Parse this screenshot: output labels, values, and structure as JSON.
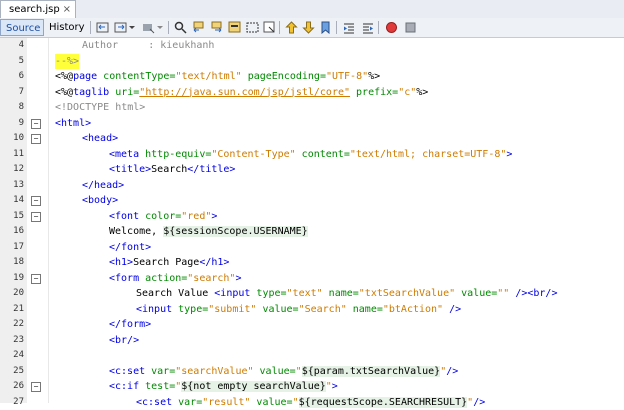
{
  "tab": {
    "filename": "search.jsp",
    "close": "×"
  },
  "toolbar": {
    "source_label": "Source",
    "history_label": "History"
  },
  "editor": {
    "lines": [
      {
        "n": "4"
      },
      {
        "n": "5"
      },
      {
        "n": "6"
      },
      {
        "n": "7"
      },
      {
        "n": "8"
      },
      {
        "n": "9"
      },
      {
        "n": "10"
      },
      {
        "n": "11"
      },
      {
        "n": "12"
      },
      {
        "n": "13"
      },
      {
        "n": "14"
      },
      {
        "n": "15"
      },
      {
        "n": "16"
      },
      {
        "n": "17"
      },
      {
        "n": "18"
      },
      {
        "n": "19"
      },
      {
        "n": "20"
      },
      {
        "n": "21"
      },
      {
        "n": "22"
      },
      {
        "n": "23"
      },
      {
        "n": "24"
      },
      {
        "n": "25"
      },
      {
        "n": "26"
      },
      {
        "n": "27"
      }
    ],
    "c4": "Author     : kieukhanh",
    "c5": "--%>",
    "c6a": "<%@",
    "c6b": "page",
    "c6c": " contentType=",
    "c6d": "\"text/html\"",
    "c6e": " pageEncoding=",
    "c6f": "\"UTF-8\"",
    "c6g": "%>",
    "c7a": "<%@",
    "c7b": "taglib",
    "c7c": " uri=",
    "c7d": "\"http://java.sun.com/jsp/jstl/core\"",
    "c7e": " prefix=",
    "c7f": "\"c\"",
    "c7g": "%>",
    "c8": "<!DOCTYPE html>",
    "c9": "<html>",
    "c10": "<head>",
    "c11a": "<meta",
    "c11b": " http-equiv=",
    "c11c": "\"Content-Type\"",
    "c11d": " content=",
    "c11e": "\"text/html; charset=UTF-8\"",
    "c11f": ">",
    "c12a": "<title>",
    "c12b": "Search",
    "c12c": "</title>",
    "c13": "</head>",
    "c14": "<body>",
    "c15a": "<font",
    "c15b": " color=",
    "c15c": "\"red\"",
    "c15d": ">",
    "c16a": "Welcome, ",
    "c16b": "${sessionScope.USERNAME}",
    "c17": "</font>",
    "c18a": "<h1>",
    "c18b": "Search Page",
    "c18c": "</h1>",
    "c19a": "<form",
    "c19b": " action=",
    "c19c": "\"search\"",
    "c19d": ">",
    "c20a": "Search Value ",
    "c20b": "<input",
    "c20c": " type=",
    "c20d": "\"text\"",
    "c20e": " name=",
    "c20f": "\"txtSearchValue\"",
    "c20g": " value=",
    "c20h": "\"\"",
    "c20i": " />",
    "c20j": "<br/>",
    "c21a": "<input",
    "c21b": " type=",
    "c21c": "\"submit\"",
    "c21d": " value=",
    "c21e": "\"Search\"",
    "c21f": " name=",
    "c21g": "\"btAction\"",
    "c21h": " />",
    "c22": "</form>",
    "c23": "<br/>",
    "c25a": "<c:set",
    "c25b": " var=",
    "c25c": "\"searchValue\"",
    "c25d": " value=",
    "c25e": "\"",
    "c25f": "${param.txtSearchValue}",
    "c25g": "\"",
    "c25h": "/>",
    "c26a": "<c:if",
    "c26b": " test=",
    "c26c": "\"",
    "c26d": "${not empty searchValue}",
    "c26e": "\"",
    "c26f": ">",
    "c27a": "<c:set",
    "c27b": " var=",
    "c27c": "\"result\"",
    "c27d": " value=",
    "c27e": "\"",
    "c27f": "${requestScope.SEARCHRESULT}",
    "c27g": "\"",
    "c27h": "/>"
  },
  "icons": [
    "back-history-icon",
    "forward-history-icon",
    "dropdown-icon",
    "find-icon",
    "find-prev-icon",
    "find-next-icon",
    "toggle-highlight-icon",
    "toggle-rect-select-icon",
    "prev-bookmark-icon",
    "next-bookmark-icon",
    "toggle-bookmark-icon",
    "shift-left-icon",
    "shift-right-icon",
    "start-macro-icon",
    "stop-macro-icon"
  ],
  "colors": {
    "tag": "#0000e6",
    "attr": "#008a00",
    "value": "#ce7b00",
    "comment": "#8a8a8a",
    "highlight": "#ffff3a"
  }
}
